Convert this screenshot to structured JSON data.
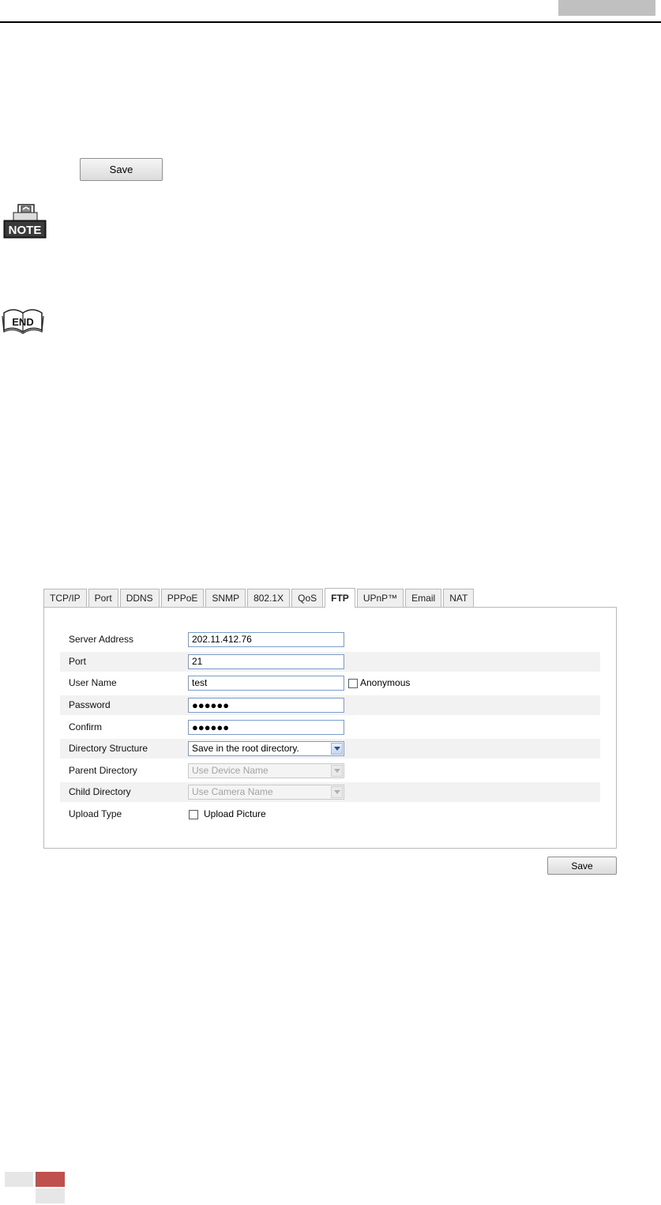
{
  "top_save": {
    "label": "Save"
  },
  "note_icon": {
    "label": "NOTE"
  },
  "end_icon": {
    "label": "END"
  },
  "tabs": [
    {
      "label": "TCP/IP",
      "active": false
    },
    {
      "label": "Port",
      "active": false
    },
    {
      "label": "DDNS",
      "active": false
    },
    {
      "label": "PPPoE",
      "active": false
    },
    {
      "label": "SNMP",
      "active": false
    },
    {
      "label": "802.1X",
      "active": false
    },
    {
      "label": "QoS",
      "active": false
    },
    {
      "label": "FTP",
      "active": true
    },
    {
      "label": "UPnP™",
      "active": false
    },
    {
      "label": "Email",
      "active": false
    },
    {
      "label": "NAT",
      "active": false
    }
  ],
  "form": {
    "server_address": {
      "label": "Server Address",
      "value": "202.11.412.76"
    },
    "port": {
      "label": "Port",
      "value": "21"
    },
    "user_name": {
      "label": "User Name",
      "value": "test",
      "anonymous_label": "Anonymous"
    },
    "password": {
      "label": "Password",
      "value": "●●●●●●"
    },
    "confirm": {
      "label": "Confirm",
      "value": "●●●●●●"
    },
    "directory_structure": {
      "label": "Directory Structure",
      "value": "Save in the root directory."
    },
    "parent_directory": {
      "label": "Parent Directory",
      "value": "Use Device Name"
    },
    "child_directory": {
      "label": "Child Directory",
      "value": "Use Camera Name"
    },
    "upload_type": {
      "label": "Upload Type",
      "option_label": "Upload Picture"
    }
  },
  "bottom_save": {
    "label": "Save"
  },
  "colors": {
    "footer_red": "#c0504d",
    "footer_gray": "#d9d9d9",
    "header_gray": "#c0c0c0"
  }
}
